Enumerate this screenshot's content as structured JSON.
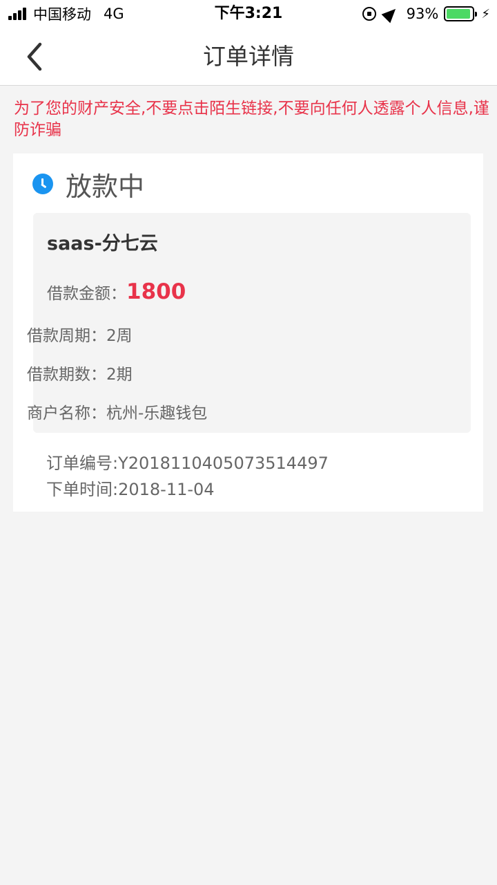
{
  "status_bar": {
    "carrier": "中国移动",
    "network": "4G",
    "time": "下午3:21",
    "battery_pct": "93%",
    "battery_level": 0.93,
    "battery_color": "#4cd964",
    "icons": [
      "signal-icon",
      "orientation-lock-icon",
      "location-arrow-icon",
      "battery-icon",
      "charging-bolt-icon"
    ]
  },
  "nav": {
    "title": "订单详情",
    "back_icon": "chevron-left-icon"
  },
  "warning": {
    "text": "为了您的财产安全,不要点击陌生链接,不要向任何人透露个人信息,谨防诈骗",
    "color": "#e8334a"
  },
  "order": {
    "status_label": "放款中",
    "status_icon": "clock-icon",
    "status_icon_color": "#1a94f0",
    "product_name": "saas-分七云",
    "amount_label": "借款金额：",
    "amount_value": "1800",
    "period_label": "借款周期：",
    "period_value": "2周",
    "installments_label": "借款期数：",
    "installments_value": "2期",
    "merchant_label": "商户名称：",
    "merchant_value": "杭州-乐趣钱包",
    "order_no_label": "订单编号:",
    "order_no_value": "Y2018110405073514497",
    "order_time_label": "下单时间:",
    "order_time_value": "2018-11-04"
  }
}
